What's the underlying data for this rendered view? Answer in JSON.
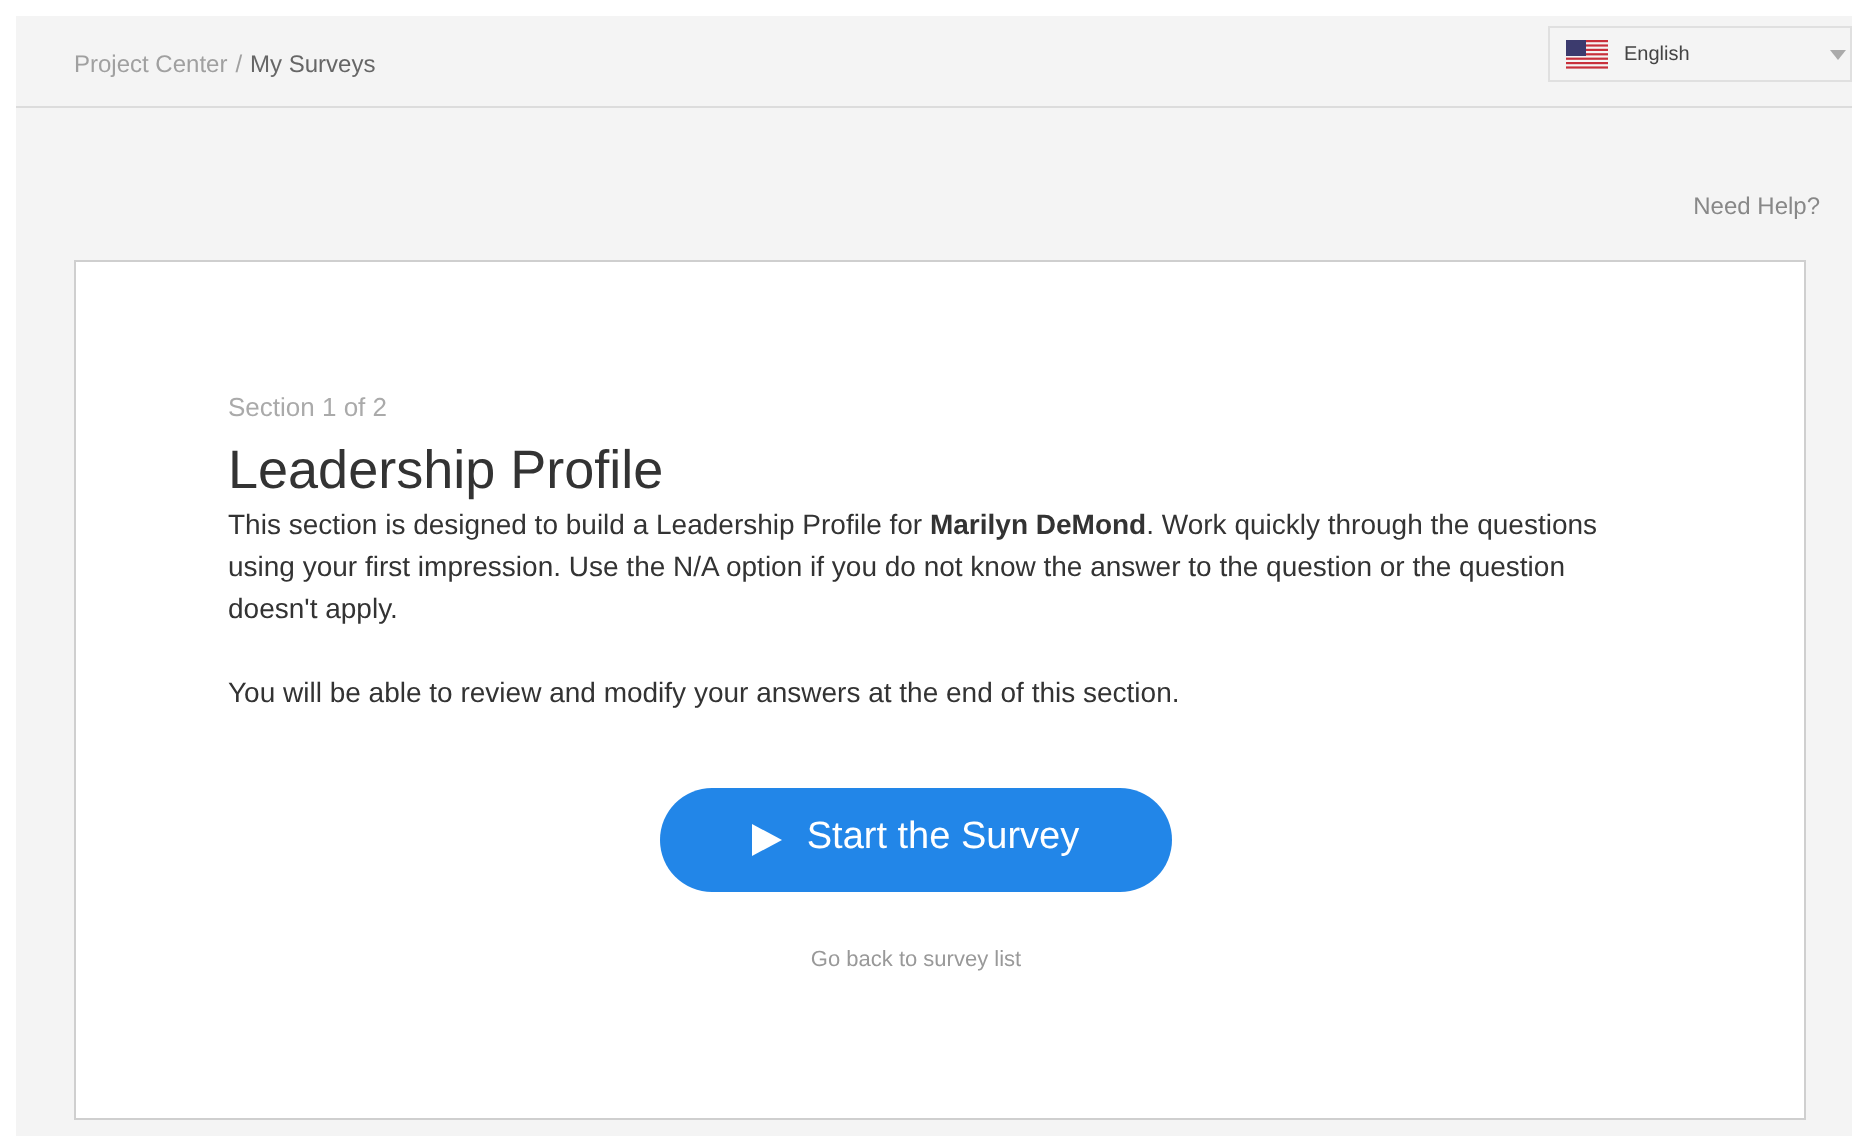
{
  "breadcrumb": {
    "parent": "Project Center",
    "separator": "/",
    "current": "My Surveys"
  },
  "language": {
    "value": "English"
  },
  "help_link": "Need Help?",
  "section": {
    "progress": "Section 1 of 2",
    "title": "Leadership Profile",
    "paragraphs": [
      "This section is designed to build a Leadership Profile for **Marilyn DeMond**. Work quickly through the questions using your first impression. Use the N/A option if you do not know the answer to the question or the question doesn't apply.",
      "You will be able to review and modify your answers at the end of this section."
    ]
  },
  "start_button": "Start the Survey",
  "back_link": "Go back to survey list"
}
